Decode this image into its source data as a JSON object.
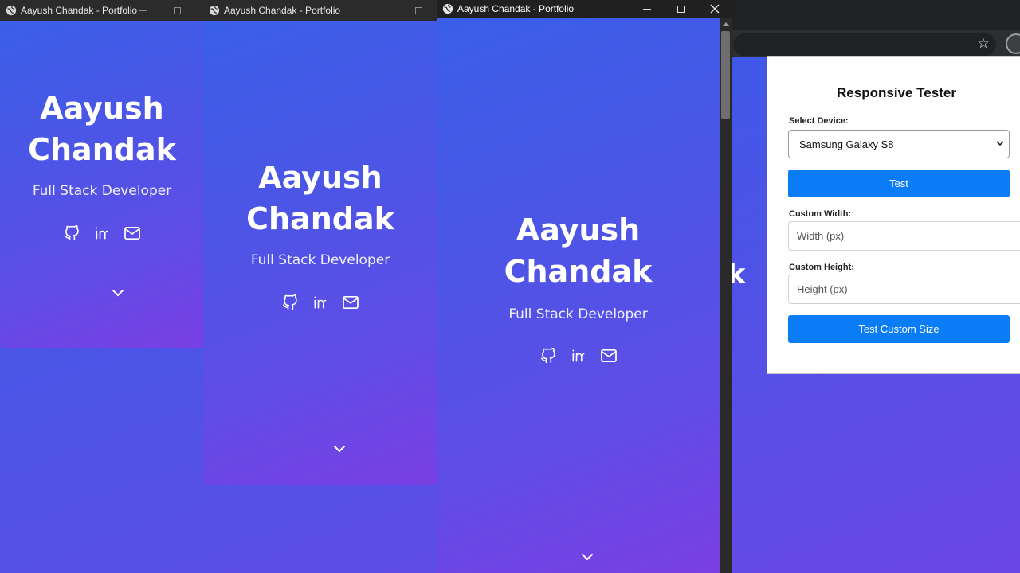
{
  "windows": [
    {
      "title": "Aayush Chandak - Portfolio",
      "name_line1": "Aayush",
      "name_line2": "Chandak",
      "role": "Full Stack Developer"
    },
    {
      "title": "Aayush Chandak - Portfolio",
      "name_line1": "Aayush",
      "name_line2": "Chandak",
      "role": "Full Stack Developer"
    },
    {
      "title": "Aayush Chandak - Portfolio",
      "name_line1": "Aayush",
      "name_line2": "Chandak",
      "role": "Full Stack Developer"
    }
  ],
  "socials": [
    "github-icon",
    "linkedin-icon",
    "mail-icon"
  ],
  "background_fragment": "k",
  "tester": {
    "title": "Responsive Tester",
    "device_label": "Select Device:",
    "device_selected": "Samsung Galaxy S8",
    "test_button": "Test",
    "width_label": "Custom Width:",
    "width_placeholder": "Width (px)",
    "height_label": "Custom Height:",
    "height_placeholder": "Height (px)",
    "custom_button": "Test Custom Size"
  },
  "colors": {
    "accent_button": "#0a7cf6",
    "gradient_start": "#3a5fe8",
    "gradient_end": "#7a3fe2",
    "titlebar": "#202020"
  }
}
